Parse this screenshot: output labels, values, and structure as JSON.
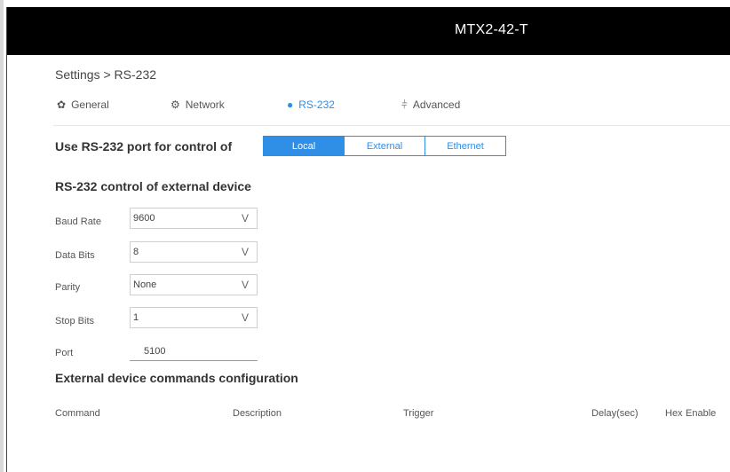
{
  "window": {
    "title": "MTX2-42-T"
  },
  "breadcrumb": "Settings > RS-232",
  "tabs": [
    {
      "label": "General",
      "icon": "gear-icon",
      "active": false
    },
    {
      "label": "Network",
      "icon": "network-icon",
      "active": false
    },
    {
      "label": "RS-232",
      "icon": "pin-icon",
      "active": true
    },
    {
      "label": "Advanced",
      "icon": "sliders-icon",
      "active": false
    }
  ],
  "control": {
    "heading": "Use RS-232 port for control of",
    "options": [
      "Local",
      "External",
      "Ethernet"
    ],
    "selected": "Local"
  },
  "external": {
    "heading": "RS-232 control of external device",
    "fields": [
      {
        "label": "Baud Rate",
        "value": "9600"
      },
      {
        "label": "Data Bits",
        "value": "8"
      },
      {
        "label": "Parity",
        "value": "None"
      },
      {
        "label": "Stop Bits",
        "value": "1"
      }
    ],
    "port": {
      "label": "Port",
      "value": "5100"
    },
    "chevron": "V"
  },
  "commands": {
    "heading": "External device commands configuration",
    "columns": [
      "Command",
      "Description",
      "Trigger",
      "Delay(sec)",
      "Hex",
      "Enable"
    ]
  },
  "colors": {
    "accent": "#2f8ee6",
    "topbar": "#000000"
  }
}
